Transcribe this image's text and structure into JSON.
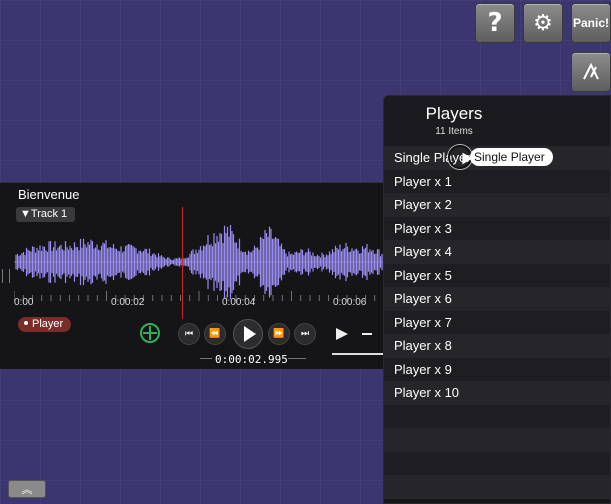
{
  "toolbar": {
    "help_label": "?",
    "settings_icon": "gear-icon",
    "panic_label": "Panic!",
    "metronome_icon": "metronome-icon",
    "play_icon": "play-icon"
  },
  "clip": {
    "title": "Bienvenue",
    "track_label": "▼Track 1",
    "player_label": "Player",
    "time_labels": [
      "0:00",
      "0:00:02",
      "0:00:04",
      "0:00:06"
    ],
    "current_time": "0:00:02.995",
    "waveform_color": "#9a8cf0",
    "playhead_color": "#c8272c",
    "loop_color": "#31b05c"
  },
  "transport": {
    "skip_back": "⏮",
    "rewind": "⏪",
    "fast_forward": "⏩",
    "skip_forward": "⏭"
  },
  "players_popup": {
    "title": "Players",
    "count": "11 Items",
    "items": [
      "Single Player",
      "Player x 1",
      "Player x 2",
      "Player x 3",
      "Player x 4",
      "Player x 5",
      "Player x 6",
      "Player x 7",
      "Player x 8",
      "Player x 9",
      "Player x 10"
    ],
    "tooltip": "Single Player"
  },
  "footer": {
    "collapse_label": "︽"
  }
}
